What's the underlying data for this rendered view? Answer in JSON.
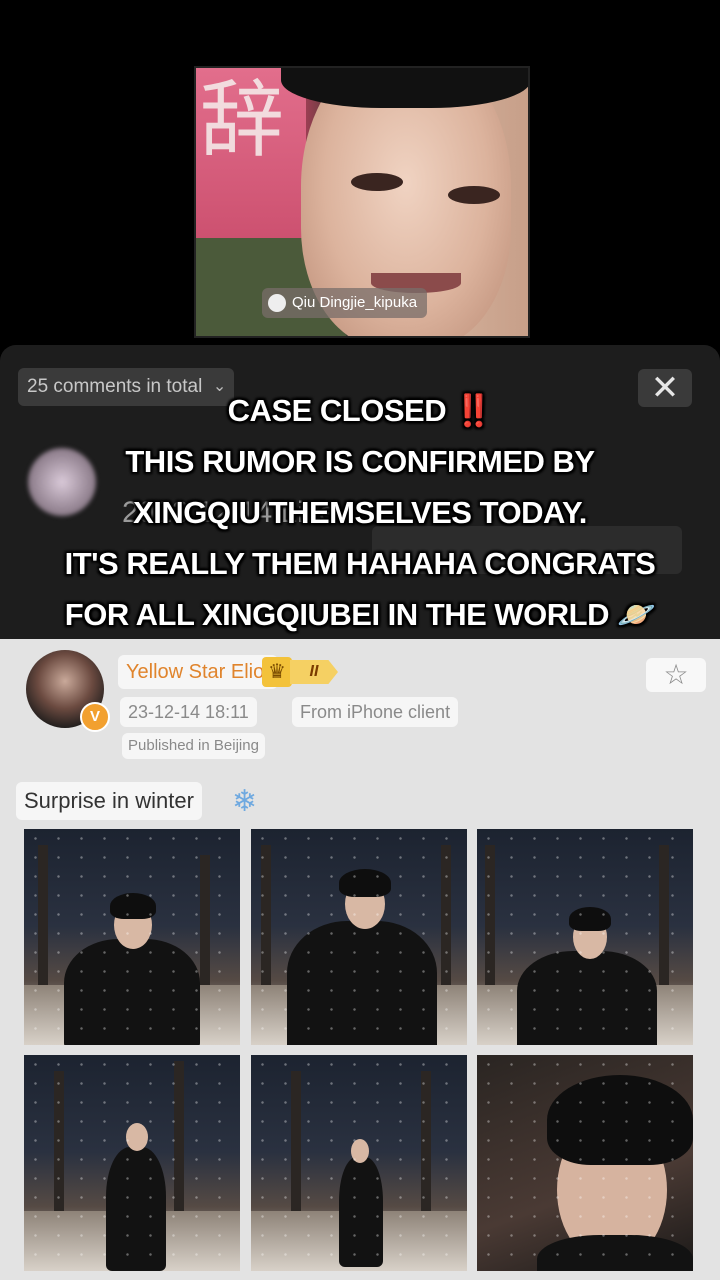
{
  "video": {
    "sign_glyph": "辞",
    "watermark": "Qiu Dingjie_kipuka"
  },
  "comment_sheet": {
    "comments_count": "25 comments in total",
    "chevron": "⌄",
    "close": "✕",
    "ghost_date": "2023.12.14 Live"
  },
  "caption": {
    "line1": "CASE CLOSED",
    "line1_emoji": "‼️",
    "line2": "THIS RUMOR IS CONFIRMED BY",
    "line3": "XINGQIU THEMSELVES TODAY.",
    "line4": "IT'S REALLY THEM HAHAHA CONGRATS",
    "line5": "FOR ALL XINGQIUBEI IN THE WORLD",
    "line5_emoji": "🪐"
  },
  "post": {
    "username": "Yellow Star Eliot",
    "verified_badge": "V",
    "rank_crown": "♛",
    "rank_level": "II",
    "timestamp": "23-12-14 18:11",
    "source": "From iPhone client",
    "location": "Published in Beijing",
    "star": "☆",
    "text": "Surprise in winter",
    "text_emoji": "❄"
  },
  "colors": {
    "username": "#e0842c",
    "badge": "#f2a02f",
    "panel_bg": "#e3e3e3"
  },
  "photos": {
    "count": 6
  }
}
